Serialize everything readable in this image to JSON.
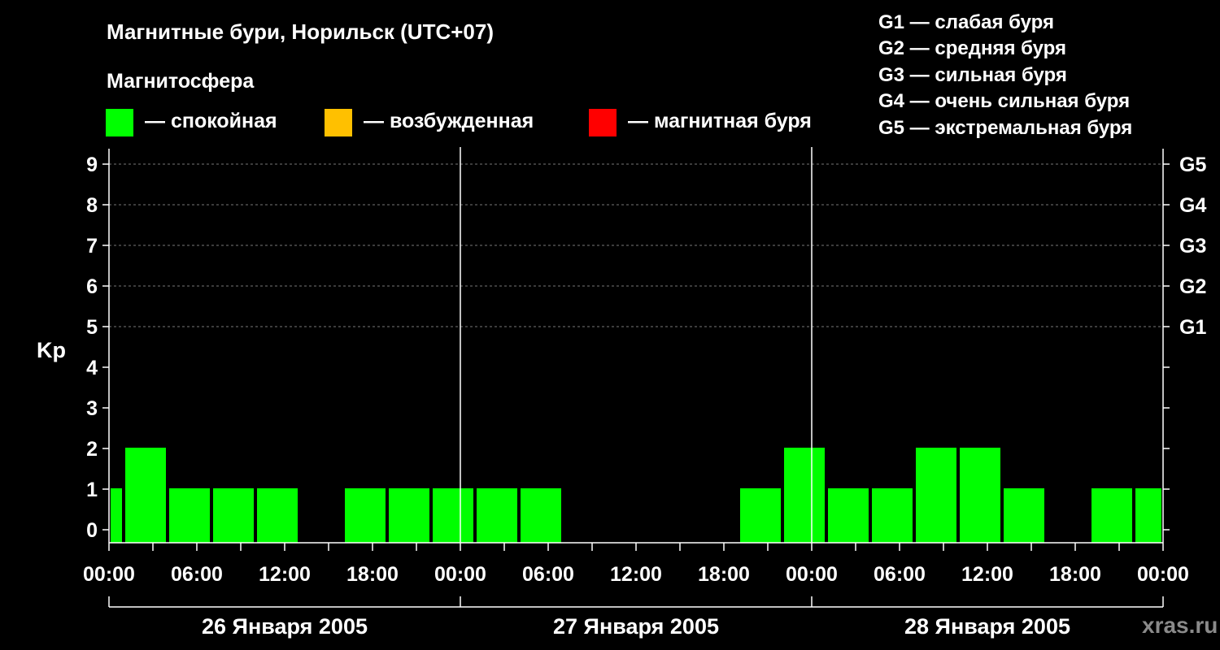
{
  "header": {
    "title": "Магнитные бури, Норильск (UTC+07)",
    "subtitle": "Магнитосфера"
  },
  "legend": {
    "items": [
      {
        "label": "— спокойная",
        "color": "#00ff00"
      },
      {
        "label": "— возбужденная",
        "color": "#ffc000"
      },
      {
        "label": "— магнитная буря",
        "color": "#ff0000"
      }
    ]
  },
  "g_legend": [
    "G1 — слабая буря",
    "G2 — средняя буря",
    "G3 — сильная буря",
    "G4 — очень сильная буря",
    "G5 — экстремальная буря"
  ],
  "watermark": "xras.ru",
  "chart_data": {
    "type": "bar",
    "title": "Магнитные бури, Норильск (UTC+07)",
    "ylabel": "Kp",
    "ylim": [
      0,
      9
    ],
    "y_ticks": [
      "0",
      "1",
      "2",
      "3",
      "4",
      "5",
      "6",
      "7",
      "8",
      "9"
    ],
    "right_ticks": [
      {
        "kp": 5,
        "label": "G1"
      },
      {
        "kp": 6,
        "label": "G2"
      },
      {
        "kp": 7,
        "label": "G3"
      },
      {
        "kp": 8,
        "label": "G4"
      },
      {
        "kp": 9,
        "label": "G5"
      }
    ],
    "x_range_hours": [
      0,
      72
    ],
    "x_tick_labels": [
      "00:00",
      "06:00",
      "12:00",
      "18:00",
      "00:00",
      "06:00",
      "12:00",
      "18:00",
      "00:00",
      "06:00",
      "12:00",
      "18:00",
      "00:00"
    ],
    "days": [
      "26 Января 2005",
      "27 Января 2005",
      "28 Января 2005"
    ],
    "grid": "dashed horizontal at Kp 5–9",
    "bar_color": "#00ff00",
    "bars": [
      {
        "start_hour": 0,
        "end_hour": 1,
        "kp": 1
      },
      {
        "start_hour": 1,
        "end_hour": 4,
        "kp": 2
      },
      {
        "start_hour": 4,
        "end_hour": 7,
        "kp": 1
      },
      {
        "start_hour": 7,
        "end_hour": 10,
        "kp": 1
      },
      {
        "start_hour": 10,
        "end_hour": 13,
        "kp": 1
      },
      {
        "start_hour": 13,
        "end_hour": 16,
        "kp": 0
      },
      {
        "start_hour": 16,
        "end_hour": 19,
        "kp": 1
      },
      {
        "start_hour": 19,
        "end_hour": 22,
        "kp": 1
      },
      {
        "start_hour": 22,
        "end_hour": 25,
        "kp": 1
      },
      {
        "start_hour": 25,
        "end_hour": 28,
        "kp": 1
      },
      {
        "start_hour": 28,
        "end_hour": 31,
        "kp": 1
      },
      {
        "start_hour": 31,
        "end_hour": 34,
        "kp": 0
      },
      {
        "start_hour": 34,
        "end_hour": 37,
        "kp": 0
      },
      {
        "start_hour": 37,
        "end_hour": 40,
        "kp": 0
      },
      {
        "start_hour": 40,
        "end_hour": 43,
        "kp": 0
      },
      {
        "start_hour": 43,
        "end_hour": 46,
        "kp": 1
      },
      {
        "start_hour": 46,
        "end_hour": 49,
        "kp": 2
      },
      {
        "start_hour": 49,
        "end_hour": 52,
        "kp": 1
      },
      {
        "start_hour": 52,
        "end_hour": 55,
        "kp": 1
      },
      {
        "start_hour": 55,
        "end_hour": 58,
        "kp": 2
      },
      {
        "start_hour": 58,
        "end_hour": 61,
        "kp": 2
      },
      {
        "start_hour": 61,
        "end_hour": 64,
        "kp": 1
      },
      {
        "start_hour": 64,
        "end_hour": 67,
        "kp": 0
      },
      {
        "start_hour": 67,
        "end_hour": 70,
        "kp": 1
      },
      {
        "start_hour": 70,
        "end_hour": 72,
        "kp": 1
      }
    ]
  }
}
